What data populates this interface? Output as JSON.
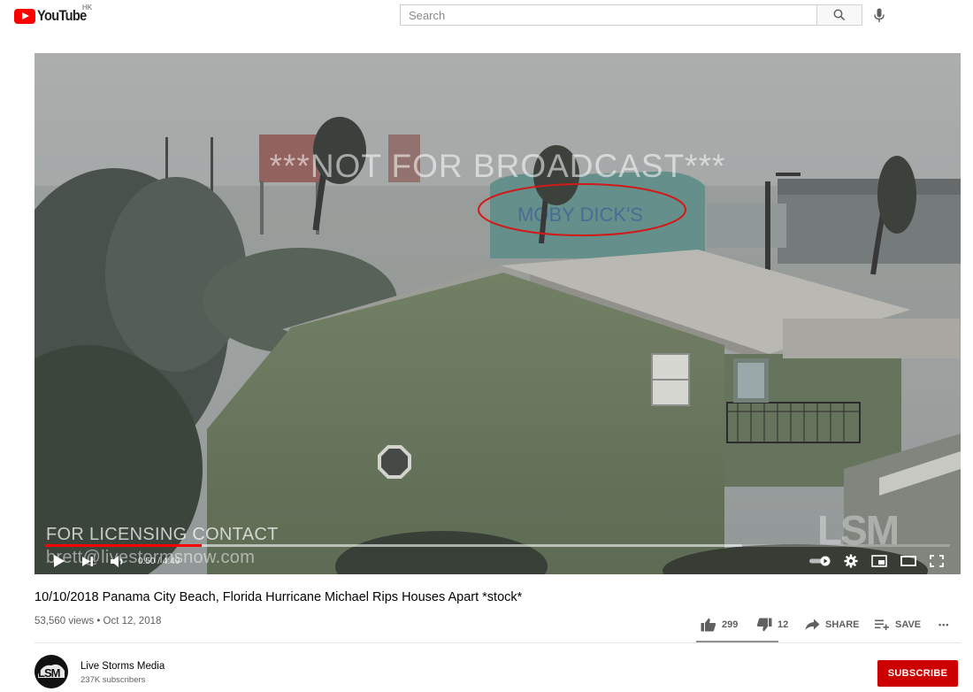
{
  "masthead": {
    "logo_text": "YouTube",
    "country_code": "HK",
    "search_placeholder": "Search",
    "icons": {
      "search": "search-icon",
      "mic": "mic-icon"
    }
  },
  "player": {
    "overlay_top": "***NOT FOR BROADCAST***",
    "sign_text": "MOBY DICK'S",
    "overlay_license_1": "FOR LICENSING CONTACT",
    "overlay_license_2": "brett@livestormsnow.com",
    "channel_watermark": "LSM",
    "time_current": "0:50",
    "time_total": "4:49",
    "time_display": "0:50 / 4:49",
    "progress_played": 0.173,
    "progress_loaded": 0.77,
    "colors": {
      "progress": "#ff0000",
      "annotation": "#d11a1a"
    }
  },
  "video": {
    "title": "10/10/2018 Panama City Beach, Florida Hurricane Michael Rips Houses Apart *stock*",
    "meta": "53,560 views • Oct 12, 2018",
    "likes": "299",
    "dislikes": "12",
    "share_label": "SHARE",
    "save_label": "SAVE",
    "more_label": "•••"
  },
  "channel": {
    "name": "Live Storms Media",
    "subscribers": "237K subscribers",
    "avatar_text": "LSM",
    "subscribe_label": "SUBSCRIBE",
    "subscribe_color": "#cc0000"
  }
}
